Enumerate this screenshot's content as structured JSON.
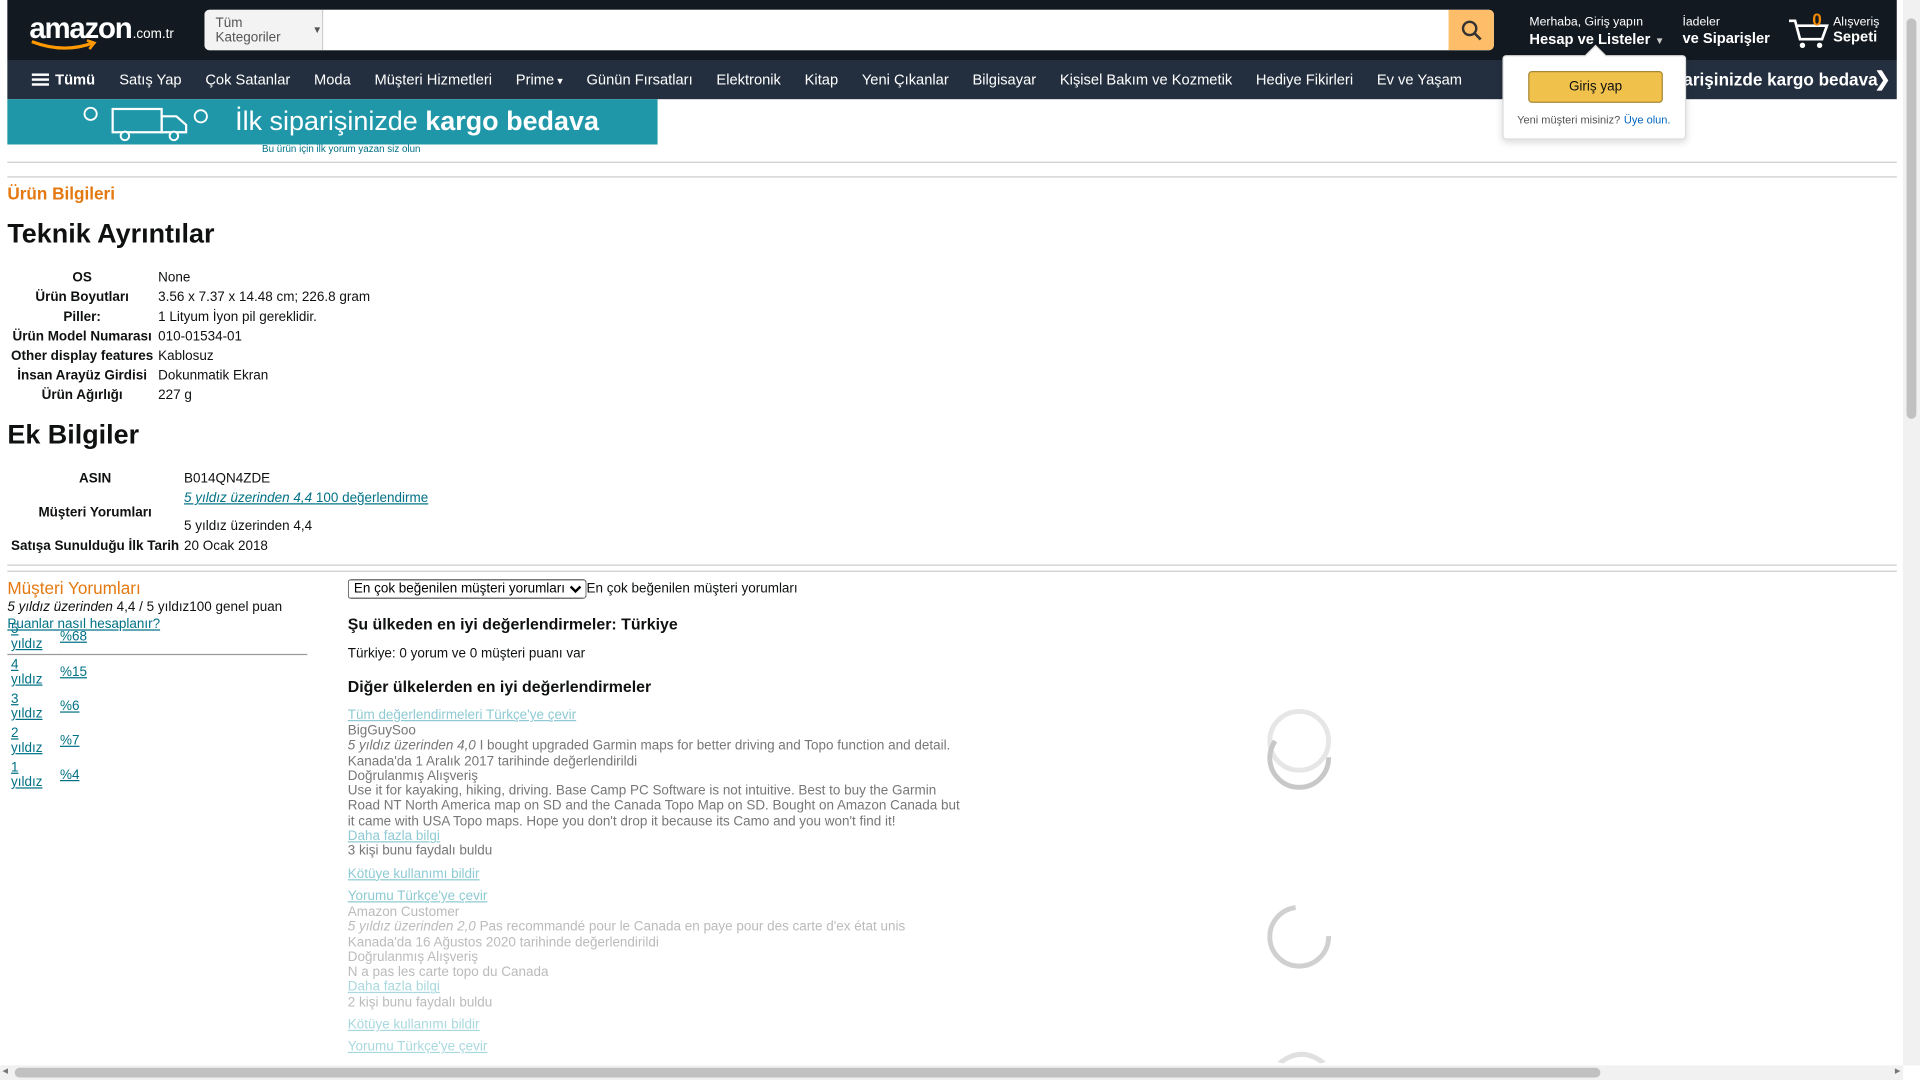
{
  "header": {
    "logo_text": "amazon",
    "logo_tld": ".com.tr",
    "search_category": "Tüm Kategoriler",
    "search_placeholder": "",
    "account_line1": "Merhaba, Giriş yapın",
    "account_line2": "Hesap ve Listeler",
    "orders_line1": "İadeler",
    "orders_line2": "ve Siparişler",
    "cart_count": "0",
    "cart_line1": "Alışveriş",
    "cart_line2": "Sepeti"
  },
  "nav": {
    "all_label": "Tümü",
    "items": [
      "Satış Yap",
      "Çok Satanlar",
      "Moda",
      "Müşteri Hizmetleri",
      "Prime",
      "Günün Fırsatları",
      "Elektronik",
      "Kitap",
      "Yeni Çıkanlar",
      "Bilgisayar",
      "Kişisel Bakım ve Kozmetik",
      "Hediye Fikirleri",
      "Ev ve Yaşam"
    ],
    "promo": "İlk siparişinizde kargo bedava",
    "promo_arrow": "❯"
  },
  "signin_popover": {
    "button": "Giriş yap",
    "new_customer": "Yeni müşteri misiniz?",
    "register_link": "Üye olun."
  },
  "banner": {
    "text_light": "İlk siparişinizde",
    "text_bold": "kargo bedava",
    "first_review_link": "Bu ürün için ilk yorum yazan siz olun"
  },
  "product_info": {
    "heading": "Ürün Bilgileri",
    "tech_heading": "Teknik Ayrıntılar",
    "tech": [
      {
        "k": "OS",
        "v": "None"
      },
      {
        "k": "Ürün Boyutları",
        "v": "3.56 x 7.37 x 14.48 cm; 226.8 gram"
      },
      {
        "k": "Piller:",
        "v": "1 Lityum İyon pil gereklidir."
      },
      {
        "k": "Ürün Model Numarası",
        "v": "010-01534-01"
      },
      {
        "k": "Other display features",
        "v": "Kablosuz"
      },
      {
        "k": "İnsan Arayüz Girdisi",
        "v": "Dokunmatik Ekran"
      },
      {
        "k": "Ürün Ağırlığı",
        "v": "227 g"
      }
    ],
    "extra_heading": "Ek Bilgiler",
    "asin_label": "ASIN",
    "asin": "B014QN4ZDE",
    "reviews_label": "Müşteri Yorumları",
    "reviews_link_italic": "5 yıldız üzerinden 4,4",
    "reviews_link_count": "100 değerlendirme",
    "reviews_text": "5 yıldız üzerinden 4,4",
    "date_label": "Satışa Sunulduğu İlk Tarih",
    "date": "20 Ocak 2018"
  },
  "reviews": {
    "title": "Müşteri Yorumları",
    "avg_italic": "5 yıldız üzerinden",
    "avg_rest": "4,4 / 5 yıldız100 genel puan",
    "how_link": "Puanlar nasıl hesaplanır?",
    "histogram": [
      {
        "stars": "5 yıldız",
        "pct": "%68"
      },
      {
        "stars": "4 yıldız",
        "pct": "%15"
      },
      {
        "stars": "3 yıldız",
        "pct": "%6"
      },
      {
        "stars": "2 yıldız",
        "pct": "%7"
      },
      {
        "stars": "1 yıldız",
        "pct": "%4"
      }
    ],
    "sort_selected": "En çok beğenilen müşteri yorumları",
    "sort_text": "En çok beğenilen müşteri yorumları",
    "country_heading": "Şu ülkeden en iyi değerlendirmeler: Türkiye",
    "country_text": "Türkiye: 0 yorum ve 0 müşteri puanı var",
    "other_heading": "Diğer ülkelerden en iyi değerlendirmeler",
    "translate_all": "Tüm değerlendirmeleri Türkçe'ye çevir",
    "items": [
      {
        "author": "BigGuySoo",
        "stars": "5 yıldız üzerinden 4,0",
        "title": "I bought upgraded Garmin maps for better driving and Topo function and detail.",
        "date": "Kanada'da 1 Aralık 2017 tarihinde değerlendirildi",
        "verified": "Doğrulanmış Alışveriş",
        "body": "Use it for kayaking, hiking, driving. Base Camp PC Software is not intuitive. Best to buy the Garmin Road NT North America map on SD and the Canada Topo Map on SD. Bought on Amazon Canada but it came with USA Topo maps. Hope you don't drop it because its Camo and you won't find it!",
        "more": "Daha fazla bilgi",
        "helpful": "3 kişi bunu faydalı buldu",
        "report": "Kötüye kullanımı bildir",
        "translate": "Yorumu Türkçe'ye çevir"
      },
      {
        "author": "Amazon Customer",
        "stars": "5 yıldız üzerinden 2,0",
        "title": "Pas recommandé pour le Canada en paye pour des carte d'ex état unis",
        "date": "Kanada'da 16 Ağustos 2020 tarihinde değerlendirildi",
        "verified": "Doğrulanmış Alışveriş",
        "body": "N a pas les carte topo du Canada",
        "more": "Daha fazla bilgi",
        "helpful": "2 kişi bunu faydalı buldu",
        "report": "Kötüye kullanımı bildir",
        "translate": "Yorumu Türkçe'ye çevir"
      }
    ]
  },
  "colors": {
    "nav_belt": "#131921",
    "nav_main": "#232f3e",
    "search_button": "#febd69",
    "section_orange": "#e47911",
    "link": "#007185",
    "banner": "#1f97a8"
  }
}
